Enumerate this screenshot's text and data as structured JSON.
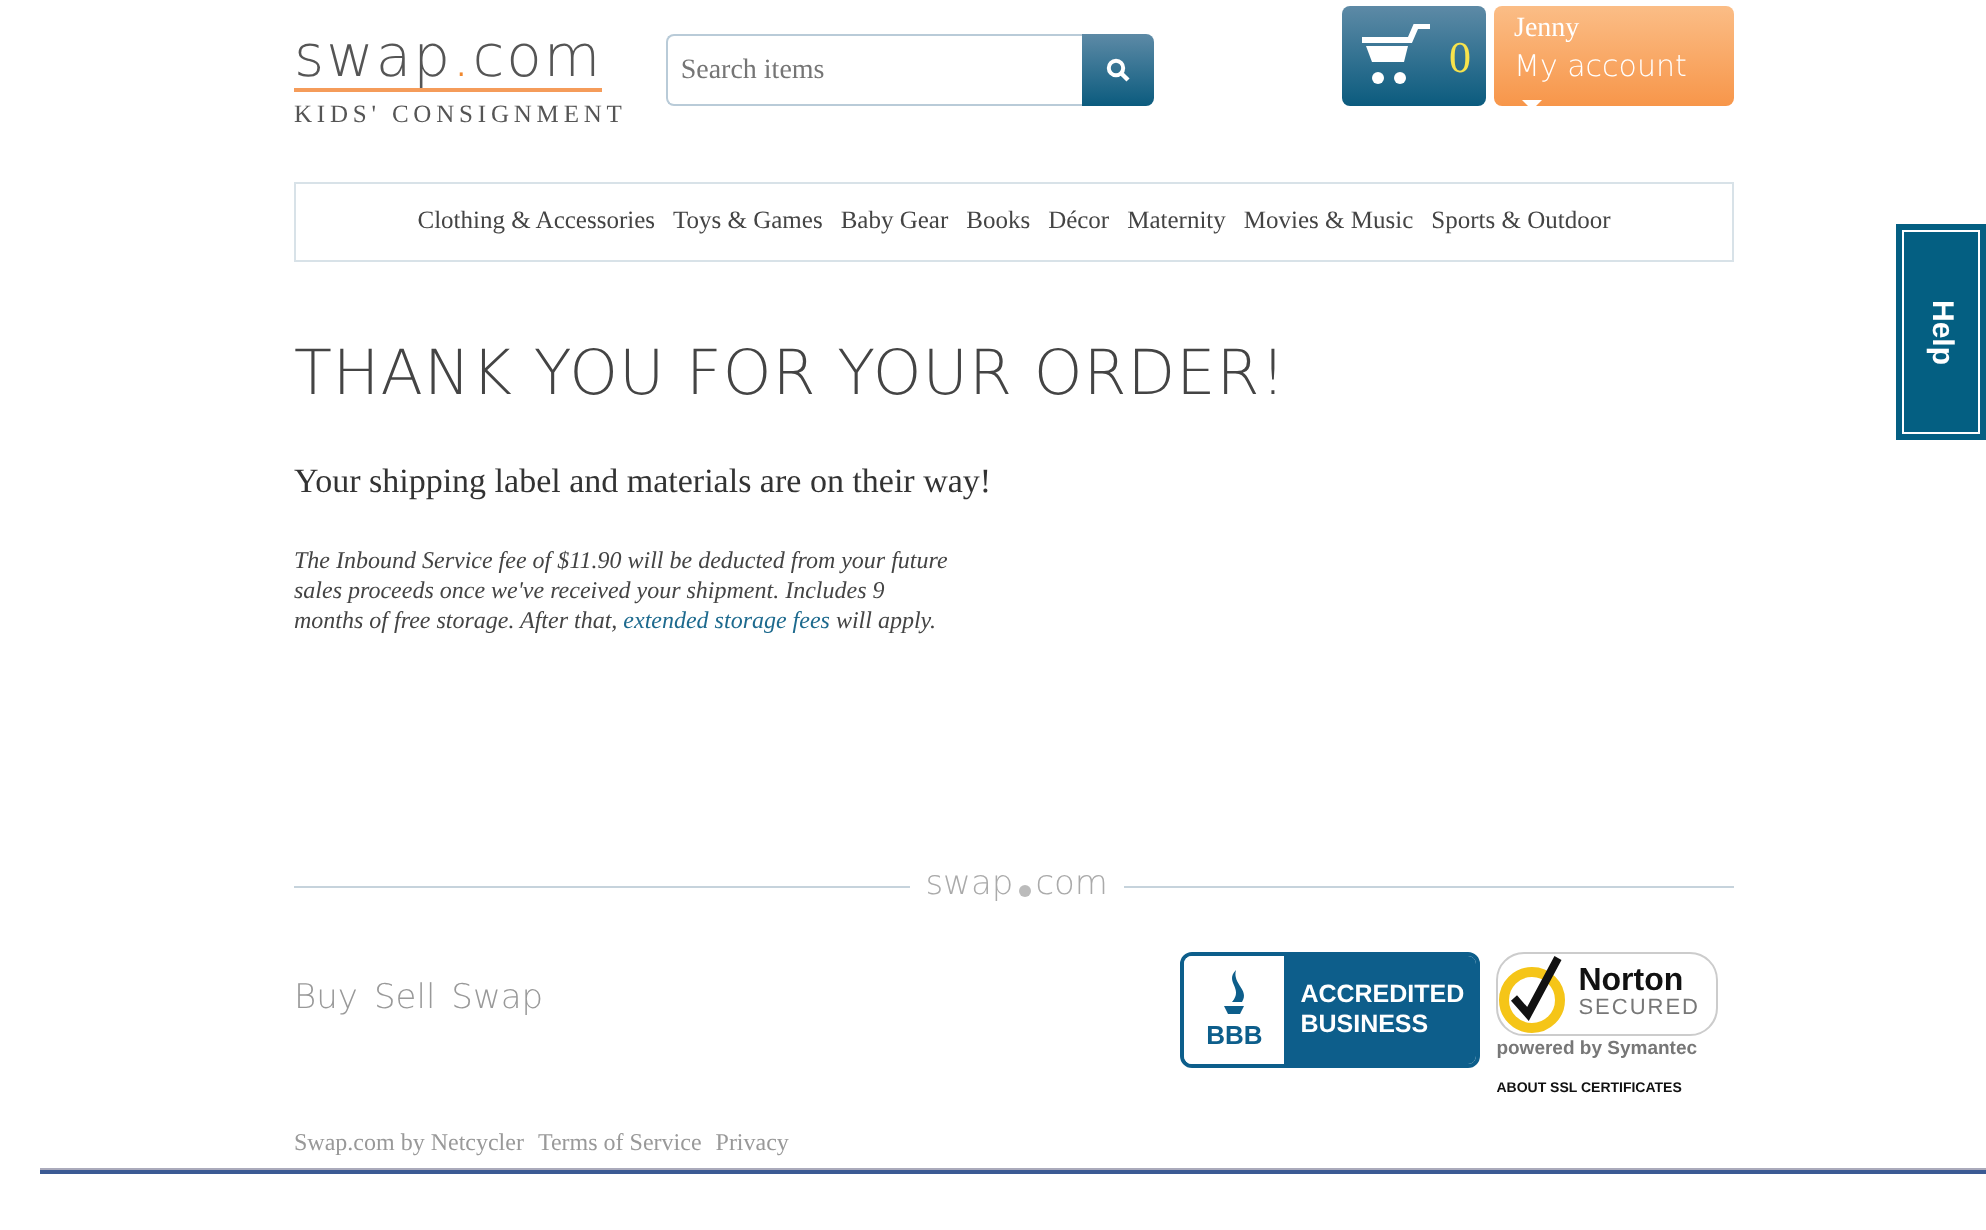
{
  "header": {
    "logo": {
      "left": "swap",
      "dot": ".",
      "right": "com",
      "tagline": "KIDS' CONSIGNMENT"
    },
    "search": {
      "placeholder": "Search items"
    },
    "cart": {
      "count": "0"
    },
    "account": {
      "user": "Jenny",
      "label": "My account"
    }
  },
  "categories": [
    "Clothing & Accessories",
    "Toys & Games",
    "Baby Gear",
    "Books",
    "Décor",
    "Maternity",
    "Movies & Music",
    "Sports & Outdoor"
  ],
  "help_tab": {
    "label": "Help"
  },
  "main": {
    "title": "THANK YOU FOR YOUR ORDER!",
    "subtitle": "Your shipping label and materials are on their way!",
    "note": "The Inbound Service fee of $11.90 will be deducted from your future sales proceeds once we've received your shipment. Includes 9 months of free storage. After that,",
    "note_link": "extended storage fees",
    "note_end": "will apply."
  },
  "footer": {
    "logo": {
      "left": "swap",
      "right": "com"
    },
    "nav": [
      "Buy",
      "Sell",
      "Swap"
    ],
    "links": [
      "Swap.com by Netcycler",
      "Terms of Service",
      "Privacy"
    ],
    "bbb": {
      "mark": "BBB",
      "text": "ACCREDITED BUSINESS"
    },
    "norton": {
      "name": "Norton",
      "secured": "SECURED",
      "powered": "powered by Symantec",
      "about": "ABOUT SSL CERTIFICATES"
    }
  }
}
